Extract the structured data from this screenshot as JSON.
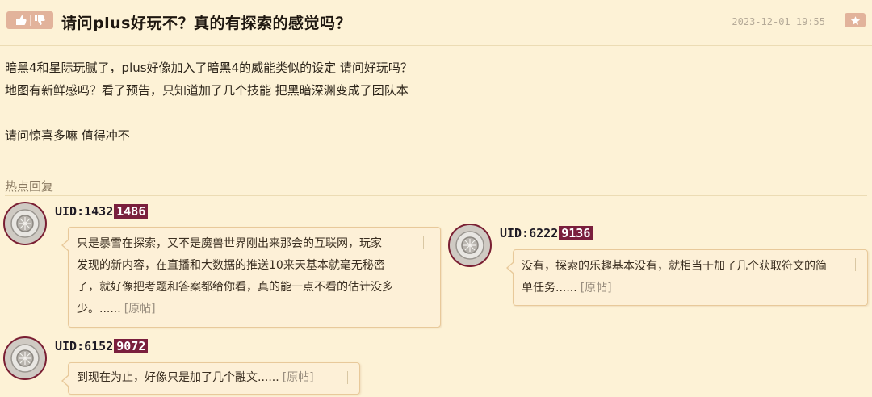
{
  "post": {
    "like_icon": "thumbs-up-icon",
    "title": "请问plus好玩不？真的有探索的感觉吗？",
    "timestamp": "2023-12-01 19:55",
    "fav_icon": "star-icon",
    "paragraphs": [
      "暗黑4和星际玩腻了，plus好像加入了暗黑4的威能类似的设定 请问好玩吗？",
      "地图有新鲜感吗？看了预告，只知道加了几个技能 把黑暗深渊变成了团队本",
      "",
      "请问惊喜多嘛 值得冲不"
    ]
  },
  "hot_replies": {
    "label": "热点回复",
    "items": [
      {
        "uid_prefix": "UID:1432",
        "uid_highlight": "1486",
        "lines": [
          "只是暴雪在探索，又不是魔兽世界刚出来那会的互联网，玩家",
          "发现的新内容，在直播和大数据的推送10来天基本就毫无秘密",
          "了，就好像把考题和答案都给你看，真的能一点不看的估计没多",
          "少。......"
        ],
        "link": "[原帖]"
      },
      {
        "uid_prefix": "UID:6222",
        "uid_highlight": "9136",
        "lines": [
          "没有，探索的乐趣基本没有，就相当于加了几个获取符文的简",
          "单任务......"
        ],
        "link": "[原帖]"
      },
      {
        "uid_prefix": "UID:6152",
        "uid_highlight": "9072",
        "lines": [
          "到现在为止，好像只是加了几个融文......"
        ],
        "link": "[原帖]"
      }
    ]
  },
  "colors": {
    "background": "#fdf2d6",
    "uid_highlight": "#7a1f3d",
    "button": "#e2b39b"
  }
}
